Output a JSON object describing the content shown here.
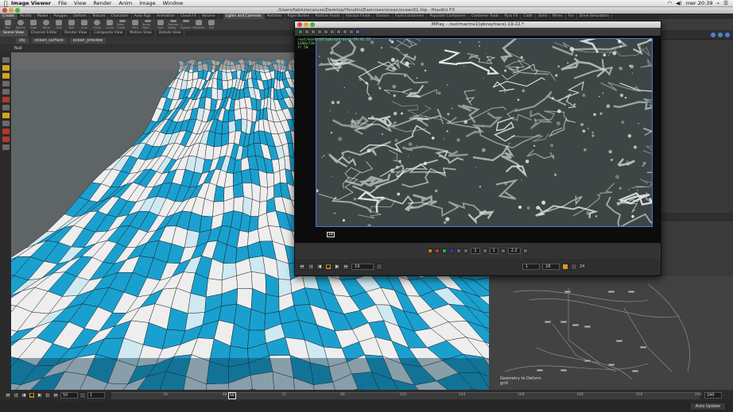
{
  "menubar": {
    "app_name": "Image Viewer",
    "menus": [
      "File",
      "View",
      "Render",
      "Anim",
      "Image",
      "Window"
    ],
    "clock": "mer 20:39"
  },
  "window": {
    "title": "/Users/fabriziocaruso/Desktop/Houdini/Exercises/ocean/ocean01.hip - Houdini FX"
  },
  "shelf_tabs_left": [
    "Create",
    "Modify",
    "Model",
    "Polygon",
    "Deform",
    "Texture",
    "Character",
    "Auto Rigs",
    "Animation",
    "Cloud FX",
    "Volume"
  ],
  "shelf_tabs_right": [
    "Lights and Cameras",
    "Particles",
    "Rigid Bodies",
    "Particle Fluids",
    "Viscous Fluids",
    "Oceans",
    "Fluid Containers",
    "Populate Containers",
    "Container Tools",
    "Pyro FX",
    "Cloth",
    "Solid",
    "Wires",
    "Fur",
    "Drive Simulation"
  ],
  "shelf_tools": [
    "Box",
    "Sphere",
    "Tube",
    "Torus",
    "Grid",
    "Null",
    "Line",
    "Circle",
    "Curve",
    "Draw Curve",
    "Path",
    "Spray Paint",
    "Font",
    "Platonic Solids",
    "L-System",
    "Metaball",
    "File"
  ],
  "view_tabs": [
    "Scene View",
    "Channel Editor",
    "Render View",
    "Composite View",
    "Motion View",
    "Details View"
  ],
  "breadcrumb": {
    "root": "obj",
    "object": "ocean_surface",
    "node": "ocean_preview"
  },
  "viewport": {
    "object_label": "Null",
    "water_color": "#1aa0cf",
    "ground_color": "#eeeeee"
  },
  "mplay": {
    "title": "MPlay - /out/mantra1(ipbraytrace)-19:22.*",
    "overlay_lines": [
      "/out/mantra1(ipbraytrace)-19:41:11",
      "1280x720",
      "fr 50"
    ],
    "gamma": "2.2",
    "start_frame": "1",
    "end_frame": "18",
    "current_frame": "19",
    "fps": "24",
    "marker": "18"
  },
  "network": {
    "note_line1": "Geometry to Deform",
    "note_line2": "grid"
  },
  "timeline": {
    "current_frame": "50",
    "start": "1",
    "end": "240",
    "cursor_label": "50",
    "ticks": [
      "24",
      "48",
      "72",
      "96",
      "120",
      "144",
      "168",
      "192",
      "216",
      "240"
    ]
  },
  "status": {
    "update_mode": "Auto Update"
  }
}
